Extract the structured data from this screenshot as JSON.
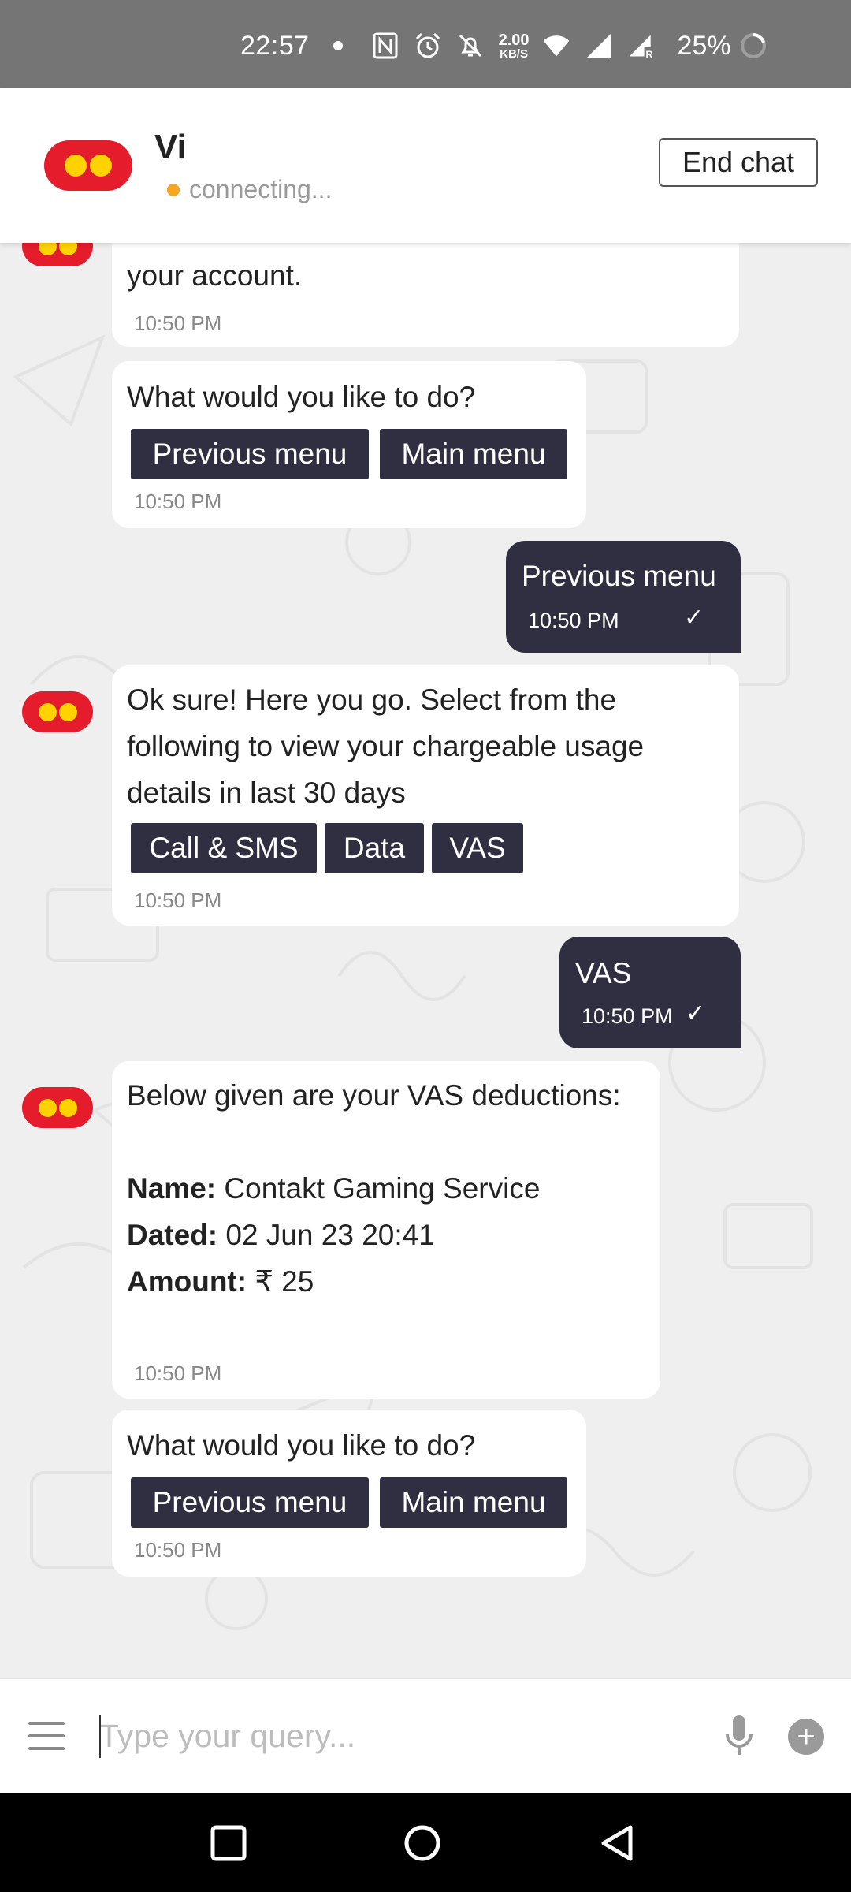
{
  "status_bar": {
    "time": "22:57",
    "speed_value": "2.00",
    "speed_unit": "KB/S",
    "battery": "25%",
    "icons": [
      "nfc-icon",
      "alarm-icon",
      "mute-icon",
      "wifi-icon",
      "signal-icon",
      "signal-roaming-icon",
      "battery-icon"
    ]
  },
  "header": {
    "name": "Vi",
    "status": "connecting...",
    "end_chat": "End chat",
    "status_color": "#f5a623",
    "brand_red": "#e51c2c",
    "brand_yellow": "#ffd200"
  },
  "messages": {
    "m1": {
      "text": "your account.",
      "time": "10:50 PM"
    },
    "m2": {
      "text": "What would you like to do?",
      "buttons": [
        "Previous menu",
        "Main menu"
      ],
      "time": "10:50 PM"
    },
    "u1": {
      "text": "Previous menu",
      "time": "10:50 PM"
    },
    "m3": {
      "lines": [
        "Ok sure! Here you go. Select from the",
        "following to view your chargeable usage",
        "details in last 30 days"
      ],
      "buttons": [
        "Call & SMS",
        "Data",
        "VAS"
      ],
      "time": "10:50 PM"
    },
    "u2": {
      "text": "VAS",
      "time": "10:50 PM"
    },
    "m4": {
      "intro": "Below given are your VAS deductions:",
      "name_label": "Name:",
      "name_value": "Contakt Gaming Service",
      "dated_label": "Dated:",
      "dated_value": "02 Jun 23 20:41",
      "amount_label": "Amount:",
      "amount_value": "₹ 25",
      "time": "10:50 PM"
    },
    "m5": {
      "text": "What would you like to do?",
      "buttons": [
        "Previous menu",
        "Main menu"
      ],
      "time": "10:50 PM"
    }
  },
  "input": {
    "placeholder": "Type your query..."
  },
  "colors": {
    "user_bubble": "#2f2f41",
    "quick_reply": "#2f2f41"
  }
}
